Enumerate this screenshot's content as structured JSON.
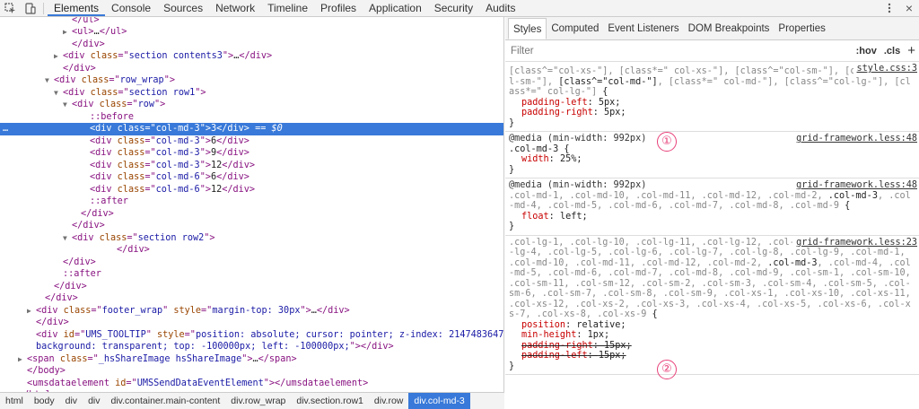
{
  "tabs": [
    "Elements",
    "Console",
    "Sources",
    "Network",
    "Timeline",
    "Profiles",
    "Application",
    "Security",
    "Audits"
  ],
  "close_label": "×",
  "dom_lines": [
    {
      "indent": 7,
      "tri": "",
      "parts": [
        [
          "tg",
          "</ul>"
        ]
      ]
    },
    {
      "indent": 7,
      "tri": "▶",
      "parts": [
        [
          "tg",
          "<ul>"
        ],
        [
          "tx",
          "…"
        ],
        [
          "tg",
          "</ul>"
        ]
      ]
    },
    {
      "indent": 7,
      "tri": "",
      "parts": [
        [
          "tg",
          "</div>"
        ]
      ]
    },
    {
      "indent": 6,
      "tri": "▶",
      "parts": [
        [
          "tg",
          "<div "
        ],
        [
          "an",
          "class"
        ],
        [
          "tg",
          "=\""
        ],
        [
          "av",
          "section contents3"
        ],
        [
          "tg",
          "\">"
        ],
        [
          "tx",
          "…"
        ],
        [
          "tg",
          "</div>"
        ]
      ]
    },
    {
      "indent": 6,
      "tri": "",
      "parts": [
        [
          "tg",
          "</div>"
        ]
      ]
    },
    {
      "indent": 5,
      "tri": "▼",
      "parts": [
        [
          "tg",
          "<div "
        ],
        [
          "an",
          "class"
        ],
        [
          "tg",
          "=\""
        ],
        [
          "av",
          "row_wrap"
        ],
        [
          "tg",
          "\">"
        ]
      ]
    },
    {
      "indent": 6,
      "tri": "▼",
      "parts": [
        [
          "tg",
          "<div "
        ],
        [
          "an",
          "class"
        ],
        [
          "tg",
          "=\""
        ],
        [
          "av",
          "section row1"
        ],
        [
          "tg",
          "\">"
        ]
      ]
    },
    {
      "indent": 7,
      "tri": "▼",
      "parts": [
        [
          "tg",
          "<div "
        ],
        [
          "an",
          "class"
        ],
        [
          "tg",
          "=\""
        ],
        [
          "av",
          "row"
        ],
        [
          "tg",
          "\">"
        ]
      ]
    },
    {
      "indent": 9,
      "tri": "",
      "parts": [
        [
          "ps",
          "::before"
        ]
      ]
    },
    {
      "indent": 9,
      "tri": "",
      "sel": true,
      "parts": [
        [
          "tg",
          "<div "
        ],
        [
          "an",
          "class"
        ],
        [
          "tg",
          "=\""
        ],
        [
          "av",
          "col-md-3"
        ],
        [
          "tg",
          "\">"
        ],
        [
          "tx",
          "3"
        ],
        [
          "tg",
          "</div>"
        ],
        [
          "eq",
          " == $0"
        ]
      ]
    },
    {
      "indent": 9,
      "tri": "",
      "parts": [
        [
          "tg",
          "<div "
        ],
        [
          "an",
          "class"
        ],
        [
          "tg",
          "=\""
        ],
        [
          "av",
          "col-md-3"
        ],
        [
          "tg",
          "\">"
        ],
        [
          "tx",
          "6"
        ],
        [
          "tg",
          "</div>"
        ]
      ]
    },
    {
      "indent": 9,
      "tri": "",
      "parts": [
        [
          "tg",
          "<div "
        ],
        [
          "an",
          "class"
        ],
        [
          "tg",
          "=\""
        ],
        [
          "av",
          "col-md-3"
        ],
        [
          "tg",
          "\">"
        ],
        [
          "tx",
          "9"
        ],
        [
          "tg",
          "</div>"
        ]
      ]
    },
    {
      "indent": 9,
      "tri": "",
      "parts": [
        [
          "tg",
          "<div "
        ],
        [
          "an",
          "class"
        ],
        [
          "tg",
          "=\""
        ],
        [
          "av",
          "col-md-3"
        ],
        [
          "tg",
          "\">"
        ],
        [
          "tx",
          "12"
        ],
        [
          "tg",
          "</div>"
        ]
      ]
    },
    {
      "indent": 9,
      "tri": "",
      "parts": [
        [
          "tg",
          "<div "
        ],
        [
          "an",
          "class"
        ],
        [
          "tg",
          "=\""
        ],
        [
          "av",
          "col-md-6"
        ],
        [
          "tg",
          "\">"
        ],
        [
          "tx",
          "6"
        ],
        [
          "tg",
          "</div>"
        ]
      ]
    },
    {
      "indent": 9,
      "tri": "",
      "parts": [
        [
          "tg",
          "<div "
        ],
        [
          "an",
          "class"
        ],
        [
          "tg",
          "=\""
        ],
        [
          "av",
          "col-md-6"
        ],
        [
          "tg",
          "\">"
        ],
        [
          "tx",
          "12"
        ],
        [
          "tg",
          "</div>"
        ]
      ]
    },
    {
      "indent": 9,
      "tri": "",
      "parts": [
        [
          "ps",
          "::after"
        ]
      ]
    },
    {
      "indent": 8,
      "tri": "",
      "parts": [
        [
          "tg",
          "</div>"
        ]
      ]
    },
    {
      "indent": 7,
      "tri": "",
      "parts": [
        [
          "tg",
          "</div>"
        ]
      ]
    },
    {
      "indent": 7,
      "tri": "▼",
      "parts": [
        [
          "tg",
          "<div "
        ],
        [
          "an",
          "class"
        ],
        [
          "tg",
          "=\""
        ],
        [
          "av",
          "section row2"
        ],
        [
          "tg",
          "\">"
        ]
      ]
    },
    {
      "indent": 12,
      "tri": "",
      "parts": [
        [
          "tg",
          "</div>"
        ]
      ]
    },
    {
      "indent": 6,
      "tri": "",
      "parts": [
        [
          "tg",
          "</div>"
        ]
      ]
    },
    {
      "indent": 6,
      "tri": "",
      "parts": [
        [
          "ps",
          "::after"
        ]
      ]
    },
    {
      "indent": 5,
      "tri": "",
      "parts": [
        [
          "tg",
          "</div>"
        ]
      ]
    },
    {
      "indent": 4,
      "tri": "",
      "parts": [
        [
          "tg",
          "</div>"
        ]
      ]
    },
    {
      "indent": 3,
      "tri": "▶",
      "parts": [
        [
          "tg",
          "<div "
        ],
        [
          "an",
          "class"
        ],
        [
          "tg",
          "=\""
        ],
        [
          "av",
          "footer_wrap"
        ],
        [
          "tg",
          "\" "
        ],
        [
          "an",
          "style"
        ],
        [
          "tg",
          "=\""
        ],
        [
          "av",
          "margin-top: 30px"
        ],
        [
          "tg",
          "\">"
        ],
        [
          "tx",
          "…"
        ],
        [
          "tg",
          "</div>"
        ]
      ]
    },
    {
      "indent": 3,
      "tri": "",
      "parts": [
        [
          "tg",
          "</div>"
        ]
      ]
    },
    {
      "indent": 3,
      "tri": "",
      "parts": [
        [
          "tg",
          "<div "
        ],
        [
          "an",
          "id"
        ],
        [
          "tg",
          "=\""
        ],
        [
          "av",
          "UMS_TOOLTIP"
        ],
        [
          "tg",
          "\" "
        ],
        [
          "an",
          "style"
        ],
        [
          "tg",
          "=\""
        ],
        [
          "av",
          "position: absolute; cursor: pointer; z-index: 2147483647;"
        ]
      ]
    },
    {
      "indent": 3,
      "tri": "",
      "parts": [
        [
          "av",
          "background: transparent; top: -100000px; left: -100000px;"
        ],
        [
          "tg",
          "\"></div>"
        ]
      ]
    },
    {
      "indent": 2,
      "tri": "▶",
      "parts": [
        [
          "tg",
          "<span "
        ],
        [
          "an",
          "class"
        ],
        [
          "tg",
          "=\""
        ],
        [
          "av",
          "_hsShareImage hsShareImage"
        ],
        [
          "tg",
          "\">"
        ],
        [
          "tx",
          "…"
        ],
        [
          "tg",
          "</span>"
        ]
      ]
    },
    {
      "indent": 2,
      "tri": "",
      "parts": [
        [
          "tg",
          "</body>"
        ]
      ]
    },
    {
      "indent": 2,
      "tri": "",
      "parts": [
        [
          "tg",
          "<umsdataelement "
        ],
        [
          "an",
          "id"
        ],
        [
          "tg",
          "=\""
        ],
        [
          "av",
          "UMSSendDataEventElement"
        ],
        [
          "tg",
          "\"></umsdataelement>"
        ]
      ]
    },
    {
      "indent": 1,
      "tri": "",
      "parts": [
        [
          "tg",
          "</html>"
        ]
      ]
    }
  ],
  "breadcrumbs": [
    "html",
    "body",
    "div",
    "div",
    "div.container.main-content",
    "div.row_wrap",
    "div.section.row1",
    "div.row",
    "div.col-md-3"
  ],
  "side_tabs": [
    "Styles",
    "Computed",
    "Event Listeners",
    "DOM Breakpoints",
    "Properties"
  ],
  "filter": {
    "placeholder": "Filter",
    "hov": ":hov",
    "cls": ".cls",
    "plus": "+"
  },
  "badges": [
    "①",
    "②"
  ],
  "rules": [
    {
      "media": "",
      "source": "style.css:3",
      "selector": [
        [
          "d",
          "[class^=\"col-xs-\"], [class*=\" col-xs-\"], [class^=\"col-sm-\"], [class*=\" col-sm-\"], "
        ],
        [
          "h",
          "[class^=\"col-md-\"]"
        ],
        [
          "d",
          ", [class*=\" col-md-\"], [class^=\"col-lg-\"], [class*=\" col-lg-\"]"
        ],
        [
          "h",
          " {"
        ]
      ],
      "decls": [
        {
          "name": "padding-left",
          "value": "5px;",
          "strike": false
        },
        {
          "name": "padding-right",
          "value": "5px;",
          "strike": false
        }
      ]
    },
    {
      "media": "@media (min-width: 992px)",
      "source": "grid-framework.less:48",
      "selector": [
        [
          "h",
          ".col-md-3 {"
        ]
      ],
      "decls": [
        {
          "name": "width",
          "value": "25%;",
          "strike": false
        }
      ]
    },
    {
      "media": "@media (min-width: 992px)",
      "source": "grid-framework.less:48",
      "selector": [
        [
          "d",
          ".col-md-1, .col-md-10, .col-md-11, .col-md-12, .col-md-2, "
        ],
        [
          "h",
          ".col-md-3"
        ],
        [
          "d",
          ", .col-md-4, .col-md-5, .col-md-6, .col-md-7, .col-md-8, .col-md-9"
        ],
        [
          "h",
          " {"
        ]
      ],
      "decls": [
        {
          "name": "float",
          "value": "left;",
          "strike": false
        }
      ]
    },
    {
      "media": "",
      "source": "grid-framework.less:23",
      "selector": [
        [
          "d",
          ".col-lg-1, .col-lg-10, .col-lg-11, .col-lg-12, .col-lg-2, .col-lg-3, .col-lg-4, .col-lg-5, .col-lg-6, .col-lg-7, .col-lg-8, .col-lg-9, .col-md-1, .col-md-10, .col-md-11, .col-md-12, .col-md-2, "
        ],
        [
          "h",
          ".col-md-3"
        ],
        [
          "d",
          ", .col-md-4, .col-md-5, .col-md-6, .col-md-7, .col-md-8, .col-md-9, .col-sm-1, .col-sm-10, .col-sm-11, .col-sm-12, .col-sm-2, .col-sm-3, .col-sm-4, .col-sm-5, .col-sm-6, .col-sm-7, .col-sm-8, .col-sm-9, .col-xs-1, .col-xs-10, .col-xs-11, .col-xs-12, .col-xs-2, .col-xs-3, .col-xs-4, .col-xs-5, .col-xs-6, .col-xs-7, .col-xs-8, .col-xs-9"
        ],
        [
          "h",
          " {"
        ]
      ],
      "decls": [
        {
          "name": "position",
          "value": "relative;",
          "strike": false
        },
        {
          "name": "min-height",
          "value": "1px;",
          "strike": false
        },
        {
          "name": "padding-right",
          "value": "15px;",
          "strike": true
        },
        {
          "name": "padding-left",
          "value": "15px;",
          "strike": true
        }
      ]
    }
  ]
}
